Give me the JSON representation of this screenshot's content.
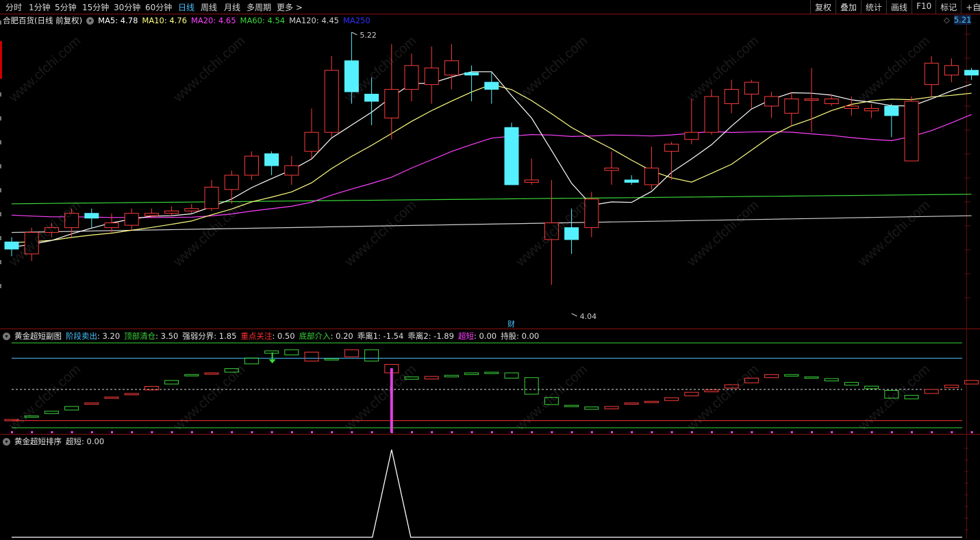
{
  "toolbar": {
    "periods": [
      "分时",
      "1分钟",
      "5分钟",
      "15分钟",
      "30分钟",
      "60分钟",
      "日线",
      "周线",
      "月线",
      "多周期",
      "更多 >"
    ],
    "active_period": "日线",
    "right_buttons": [
      "复权",
      "叠加",
      "统计",
      "画线",
      "F10",
      "标记",
      "+自选"
    ]
  },
  "main": {
    "stock_title": "合肥百货(日线 前复权)",
    "ma_indicators": [
      {
        "label": "MA5: 4.78",
        "color": "#ffffff"
      },
      {
        "label": "MA10: 4.76",
        "color": "#ffff80"
      },
      {
        "label": "MA20: 4.65",
        "color": "#ff40ff"
      },
      {
        "label": "MA60: 4.54",
        "color": "#3ad63a"
      },
      {
        "label": "MA120: 4.45",
        "color": "#d0d0d0"
      },
      {
        "label": "MA250",
        "color": "#3030ff"
      }
    ],
    "high_label": "5.22",
    "low_label": "4.04",
    "finance_marker": "财",
    "right_price": "5.21"
  },
  "sub1": {
    "title": "黄金超短副图",
    "indicators": [
      {
        "label": "阶段卖出",
        "value": "3.20",
        "color": "#49c2ff"
      },
      {
        "label": "顶部清仓",
        "value": "3.50",
        "color": "#3ad63a"
      },
      {
        "label": "强弱分界",
        "value": "1.85",
        "color": "#e0e0e0"
      },
      {
        "label": "重点关注",
        "value": "0.50",
        "color": "#ff3030"
      },
      {
        "label": "底部介入",
        "value": "0.20",
        "color": "#3ad63a"
      },
      {
        "label": "乖离1",
        "value": "-1.54",
        "color": "#e0e0e0"
      },
      {
        "label": "乖离2",
        "value": "-1.89",
        "color": "#e0e0e0"
      },
      {
        "label": "超短",
        "value": "0.00",
        "color": "#ff40ff"
      },
      {
        "label": "持股",
        "value": "0.00",
        "color": "#e0e0e0"
      }
    ]
  },
  "sub2": {
    "title": "黄金超短排序",
    "indicators": [
      {
        "label": "超短",
        "value": "0.00",
        "color": "#e0e0e0"
      }
    ]
  },
  "watermark": "www.cfchi.com",
  "colors": {
    "up": "#ff3b3b",
    "down": "#55f0ff",
    "background": "#000000"
  },
  "chart_data": {
    "type": "candlestick",
    "series_name": "合肥百货",
    "ohlc": [
      [
        4.34,
        4.36,
        4.28,
        4.31
      ],
      [
        4.29,
        4.4,
        4.26,
        4.38
      ],
      [
        4.38,
        4.42,
        4.36,
        4.4
      ],
      [
        4.4,
        4.48,
        4.36,
        4.46
      ],
      [
        4.46,
        4.48,
        4.4,
        4.44
      ],
      [
        4.4,
        4.46,
        4.38,
        4.42
      ],
      [
        4.41,
        4.48,
        4.39,
        4.46
      ],
      [
        4.45,
        4.48,
        4.44,
        4.46
      ],
      [
        4.46,
        4.49,
        4.45,
        4.47
      ],
      [
        4.47,
        4.5,
        4.46,
        4.48
      ],
      [
        4.48,
        4.6,
        4.47,
        4.57
      ],
      [
        4.56,
        4.64,
        4.5,
        4.62
      ],
      [
        4.62,
        4.72,
        4.6,
        4.7
      ],
      [
        4.71,
        4.72,
        4.62,
        4.66
      ],
      [
        4.62,
        4.7,
        4.58,
        4.66
      ],
      [
        4.72,
        4.9,
        4.69,
        4.8
      ],
      [
        4.8,
        5.12,
        4.78,
        5.06
      ],
      [
        5.1,
        5.22,
        4.92,
        4.97
      ],
      [
        4.96,
        5.03,
        4.83,
        4.93
      ],
      [
        4.86,
        5.17,
        4.77,
        4.98
      ],
      [
        4.98,
        5.13,
        4.93,
        5.08
      ],
      [
        5.0,
        5.16,
        4.92,
        5.07
      ],
      [
        5.04,
        5.17,
        4.98,
        5.1
      ],
      [
        5.05,
        5.08,
        4.93,
        5.04
      ],
      [
        5.01,
        5.05,
        4.92,
        4.98
      ],
      [
        4.82,
        4.84,
        4.58,
        4.58
      ],
      [
        4.59,
        4.69,
        4.58,
        4.6
      ],
      [
        4.35,
        4.6,
        4.16,
        4.42
      ],
      [
        4.4,
        4.48,
        4.29,
        4.35
      ],
      [
        4.4,
        4.55,
        4.36,
        4.52
      ],
      [
        4.64,
        4.72,
        4.58,
        4.65
      ],
      [
        4.6,
        4.62,
        4.58,
        4.59
      ],
      [
        4.58,
        4.74,
        4.56,
        4.65
      ],
      [
        4.72,
        4.76,
        4.6,
        4.75
      ],
      [
        4.77,
        4.94,
        4.75,
        4.8
      ],
      [
        4.8,
        4.98,
        4.79,
        4.95
      ],
      [
        4.92,
        5.02,
        4.88,
        4.98
      ],
      [
        4.96,
        5.02,
        4.9,
        5.01
      ],
      [
        4.91,
        4.97,
        4.86,
        4.95
      ],
      [
        4.88,
        4.97,
        4.83,
        4.94
      ],
      [
        4.94,
        5.07,
        4.8,
        4.94
      ],
      [
        4.92,
        4.96,
        4.91,
        4.94
      ],
      [
        4.9,
        4.95,
        4.87,
        4.91
      ],
      [
        4.89,
        4.92,
        4.86,
        4.9
      ],
      [
        4.91,
        4.92,
        4.78,
        4.87
      ],
      [
        4.68,
        4.95,
        4.76,
        4.93
      ],
      [
        5.0,
        5.12,
        4.95,
        5.09
      ],
      [
        5.04,
        5.11,
        5.01,
        5.08
      ],
      [
        5.06,
        5.07,
        5.02,
        5.04
      ]
    ],
    "ma5_last": 4.78,
    "ma10_last": 4.76,
    "ma20_last": 4.65,
    "ma60_last": 4.54,
    "ma120_last": 4.45,
    "sub1_boxes": [
      [
        0.55,
        0.55
      ],
      [
        0.7,
        0.65
      ],
      [
        0.9,
        0.8
      ],
      [
        1.1,
        0.95
      ],
      [
        1.22,
        1.25
      ],
      [
        1.45,
        1.5
      ],
      [
        1.62,
        1.65
      ],
      [
        1.8,
        1.95
      ],
      [
        2.2,
        2.05
      ],
      [
        2.45,
        2.4
      ],
      [
        2.5,
        2.52
      ],
      [
        2.7,
        2.55
      ],
      [
        3.15,
        2.9
      ],
      [
        3.45,
        3.35
      ],
      [
        3.5,
        3.28
      ],
      [
        3.02,
        3.4
      ],
      [
        3.12,
        3.08
      ],
      [
        3.2,
        3.5
      ],
      [
        3.5,
        3.02
      ],
      [
        2.52,
        2.88
      ],
      [
        2.35,
        2.25
      ],
      [
        2.26,
        2.37
      ],
      [
        2.42,
        2.35
      ],
      [
        2.52,
        2.45
      ],
      [
        2.55,
        2.52
      ],
      [
        2.52,
        2.3
      ],
      [
        2.32,
        1.62
      ],
      [
        1.48,
        1.18
      ],
      [
        1.15,
        1.1
      ],
      [
        1.08,
        0.98
      ],
      [
        1.0,
        1.1
      ],
      [
        1.22,
        1.25
      ],
      [
        1.3,
        1.32
      ],
      [
        1.35,
        1.47
      ],
      [
        1.55,
        1.7
      ],
      [
        1.72,
        1.8
      ],
      [
        1.88,
        2.02
      ],
      [
        2.1,
        2.3
      ],
      [
        2.32,
        2.45
      ],
      [
        2.45,
        2.38
      ],
      [
        2.35,
        2.3
      ],
      [
        2.28,
        2.18
      ],
      [
        2.12,
        2.0
      ],
      [
        1.96,
        1.85
      ],
      [
        1.78,
        1.45
      ],
      [
        1.57,
        1.42
      ],
      [
        1.65,
        1.82
      ],
      [
        1.9,
        2.0
      ],
      [
        2.05,
        2.2
      ]
    ],
    "sub1_levels": {
      "stage_sell": 3.2,
      "top_clear": 3.5,
      "strength_divide": 1.85,
      "focus": 0.5,
      "bottom_entry": 0.2
    },
    "sub2_spike_index": 19,
    "sub2_spike_value": 1.0
  }
}
